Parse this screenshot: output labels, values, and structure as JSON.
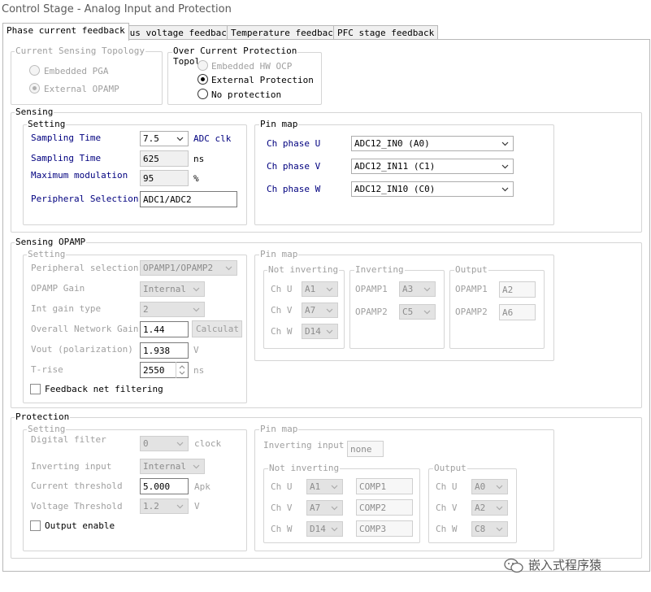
{
  "window": {
    "title": "Control Stage - Analog Input and Protection"
  },
  "tabs": [
    {
      "label": "Phase current feedback"
    },
    {
      "label": "Bus voltage feedback"
    },
    {
      "label": "Temperature feedback"
    },
    {
      "label": "PFC stage feedback"
    }
  ],
  "topology": {
    "legend": "Current Sensing Topology",
    "options": [
      "Embedded PGA",
      "External OPAMP"
    ],
    "selected": "External OPAMP"
  },
  "ocp": {
    "legend": "Over Current Protection",
    "legend_second": "Topol",
    "options": [
      "Embedded HW OCP",
      "External Protection",
      "No protection"
    ],
    "selected": "External Protection"
  },
  "sensing": {
    "legend": "Sensing",
    "setting": {
      "legend": "Setting",
      "sampling_time_label": "Sampling Time",
      "sampling_time_value": "7.5",
      "sampling_time_unit": "ADC clk",
      "sampling_time_ns_label": "Sampling Time",
      "sampling_time_ns_value": "625",
      "sampling_time_ns_unit": "ns",
      "max_mod_label": "Maximum modulation",
      "max_mod_value": "95",
      "max_mod_unit": "%",
      "peripheral_label": "Peripheral Selection",
      "peripheral_value": "ADC1/ADC2"
    },
    "pinmap": {
      "legend": "Pin map",
      "rows": [
        {
          "label": "Ch phase U",
          "value": "ADC12_IN0 (A0)"
        },
        {
          "label": "Ch phase V",
          "value": "ADC12_IN11 (C1)"
        },
        {
          "label": "Ch phase W",
          "value": "ADC12_IN10 (C0)"
        }
      ]
    }
  },
  "opamp": {
    "legend": "Sensing OPAMP",
    "setting": {
      "legend": "Setting",
      "peripheral_label": "Peripheral selection",
      "peripheral_value": "OPAMP1/OPAMP2",
      "gain_label": "OPAMP Gain",
      "gain_value": "Internal",
      "int_gain_label": "Int gain type",
      "int_gain_value": "2",
      "network_gain_label": "Overall Network Gain",
      "network_gain_value": "1.44",
      "calc_button": "Calculat",
      "vout_label": "Vout (polarization)",
      "vout_value": "1.938",
      "vout_unit": "V",
      "trise_label": "T-rise",
      "trise_value": "2550",
      "trise_unit": "ns",
      "filter_label": "Feedback net filtering"
    },
    "pinmap": {
      "legend": "Pin map",
      "not_inverting": {
        "legend": "Not inverting",
        "rows": [
          {
            "label": "Ch U",
            "value": "A1"
          },
          {
            "label": "Ch V",
            "value": "A7"
          },
          {
            "label": "Ch W",
            "value": "D14"
          }
        ]
      },
      "inverting": {
        "legend": "Inverting",
        "rows": [
          {
            "label": "OPAMP1",
            "value": "A3"
          },
          {
            "label": "OPAMP2",
            "value": "C5"
          }
        ]
      },
      "output": {
        "legend": "Output",
        "rows": [
          {
            "label": "OPAMP1",
            "value": "A2"
          },
          {
            "label": "OPAMP2",
            "value": "A6"
          }
        ]
      }
    }
  },
  "protection": {
    "legend": "Protection",
    "setting": {
      "legend": "Setting",
      "filter_label": "Digital filter",
      "filter_value": "0",
      "filter_unit": "clock",
      "inv_label": "Inverting input",
      "inv_value": "Internal",
      "current_label": "Current threshold",
      "current_value": "5.000",
      "current_unit": "Apk",
      "voltage_label": "Voltage Threshold",
      "voltage_value": "1.2",
      "voltage_unit": "V",
      "output_label": "Output enable"
    },
    "pinmap": {
      "legend": "Pin map",
      "inv_label": "Inverting input",
      "inv_value": "none",
      "not_inverting": {
        "legend": "Not inverting",
        "rows": [
          {
            "label": "Ch U",
            "value": "A1",
            "comp": "COMP1"
          },
          {
            "label": "Ch V",
            "value": "A7",
            "comp": "COMP2"
          },
          {
            "label": "Ch W",
            "value": "D14",
            "comp": "COMP3"
          }
        ]
      },
      "output": {
        "legend": "Output",
        "rows": [
          {
            "label": "Ch U",
            "value": "A0"
          },
          {
            "label": "Ch V",
            "value": "A2"
          },
          {
            "label": "Ch W",
            "value": "C8"
          }
        ]
      }
    }
  },
  "watermark": {
    "text": "嵌入式程序猿"
  }
}
